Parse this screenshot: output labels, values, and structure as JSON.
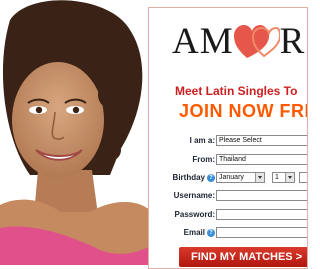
{
  "logo": {
    "text_left": "AM",
    "text_right": "R"
  },
  "headline": {
    "tagline": "Meet Latin Singles To",
    "join": "JOIN NOW FRE"
  },
  "form": {
    "i_am": {
      "label": "I am a:",
      "value": "Please Select"
    },
    "from": {
      "label": "From:",
      "value": "Thailand"
    },
    "birthday": {
      "label": "Birthday",
      "month": "January",
      "day": "1"
    },
    "username": {
      "label": "Username:",
      "value": ""
    },
    "password": {
      "label": "Password:",
      "value": ""
    },
    "email": {
      "label": "Email",
      "value": ""
    },
    "help_glyph": "?"
  },
  "cta": {
    "label": "FIND MY MATCHES >"
  },
  "colors": {
    "brand_red": "#cc1f1f",
    "orange": "#ff5a00",
    "cta_red": "#c52a1d",
    "help_blue": "#3a8fd8"
  },
  "icons": {
    "logo_mark": "hearts-icon",
    "help": "help-icon",
    "dropdown": "chevron-down-icon"
  }
}
